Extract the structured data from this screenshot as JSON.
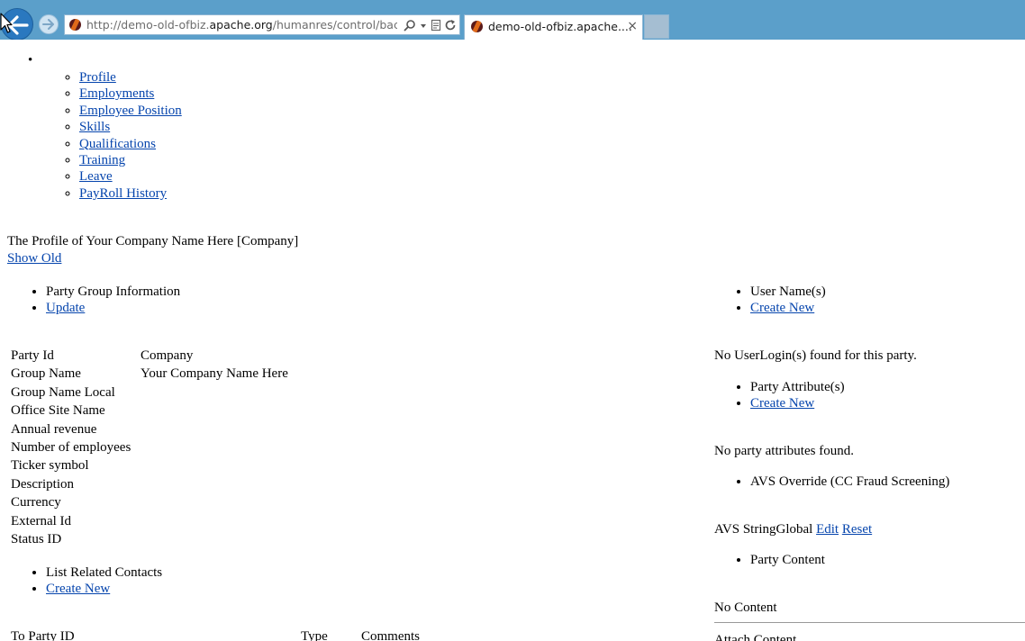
{
  "browser": {
    "url_prefix": "http://demo-old-ofbiz.",
    "url_domain": "apache.org",
    "url_path": "/humanres/control/backH",
    "tab_title": "demo-old-ofbiz.apache....",
    "tab_close": "×"
  },
  "nav": {
    "items": [
      {
        "label": "Profile"
      },
      {
        "label": "Employments"
      },
      {
        "label": "Employee Position"
      },
      {
        "label": "Skills"
      },
      {
        "label": "Qualifications"
      },
      {
        "label": "Training"
      },
      {
        "label": "Leave"
      },
      {
        "label": "PayRoll History"
      }
    ]
  },
  "header": {
    "title": "The Profile of Your Company Name Here [Company]",
    "show_old": "Show Old"
  },
  "party_group": {
    "heading": "Party Group Information",
    "update": "Update",
    "rows": [
      {
        "label": "Party Id",
        "value": "Company"
      },
      {
        "label": "Group Name",
        "value": "Your Company Name Here"
      },
      {
        "label": "Group Name Local",
        "value": ""
      },
      {
        "label": "Office Site Name",
        "value": ""
      },
      {
        "label": "Annual revenue",
        "value": ""
      },
      {
        "label": "Number of employees",
        "value": ""
      },
      {
        "label": "Ticker symbol",
        "value": ""
      },
      {
        "label": "Description",
        "value": ""
      },
      {
        "label": "Currency",
        "value": ""
      },
      {
        "label": "External Id",
        "value": ""
      },
      {
        "label": "Status ID",
        "value": ""
      }
    ]
  },
  "related_contacts": {
    "heading": "List Related Contacts",
    "create_new": "Create New",
    "columns": [
      "To Party ID",
      "Type",
      "Comments"
    ]
  },
  "user_names": {
    "heading": "User Name(s)",
    "create_new": "Create New",
    "empty": "No UserLogin(s) found for this party."
  },
  "party_attributes": {
    "heading": "Party Attribute(s)",
    "create_new": "Create New",
    "empty": "No party attributes found."
  },
  "avs": {
    "heading": "AVS Override (CC Fraud Screening)",
    "label": "AVS StringGlobal",
    "edit": "Edit",
    "reset": "Reset"
  },
  "party_content": {
    "heading": "Party Content",
    "empty": "No Content",
    "attach": "Attach Content"
  }
}
